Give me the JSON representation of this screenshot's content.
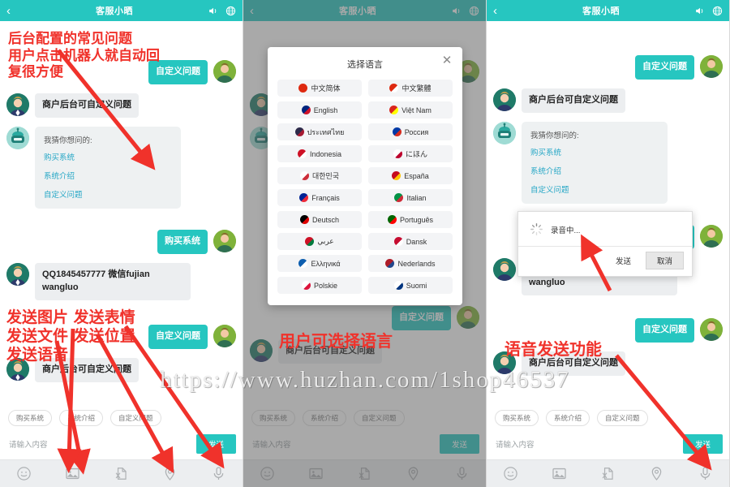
{
  "header": {
    "back_icon": "chevron-left-icon",
    "title": "客服小晒",
    "sound_icon": "sound-icon",
    "globe_icon": "globe-icon"
  },
  "chat": {
    "bot_question_intro": "我猜你想问的:",
    "faq_links": [
      "购买系统",
      "系统介绍",
      "自定义问题"
    ],
    "agent_msg": "商户后台可自定义问题",
    "user_msg_buy": "购买系统",
    "agent_contact": "QQ1845457777 微信fujian wangluo",
    "user_msg_custom": "自定义问题"
  },
  "chips": [
    "购买系统",
    "系统介绍",
    "自定义问题"
  ],
  "input": {
    "placeholder": "请输入内容",
    "send_label": "发送"
  },
  "toolbar": {
    "items": [
      {
        "icon": "smiley-icon",
        "name": "emoji-button"
      },
      {
        "icon": "image-icon",
        "name": "image-button"
      },
      {
        "icon": "file-icon",
        "name": "file-button"
      },
      {
        "icon": "location-pin-icon",
        "name": "location-button"
      },
      {
        "icon": "microphone-icon",
        "name": "voice-button"
      }
    ]
  },
  "annotations": {
    "left": "后台配置的常见问题\n用户点击机器人就自动回\n复很方便",
    "left2": "发送图片 发送表情\n发送文件 发送位置\n发送语音",
    "middle": "用户可选择语言",
    "right": "语音发送功能"
  },
  "language_modal": {
    "title": "选择语言",
    "close_icon": "close-icon",
    "items": [
      {
        "label": "中文简体",
        "flag": "#de2910",
        "flag2": "#de2910"
      },
      {
        "label": "中文繁體",
        "flag": "#de2910",
        "flag2": "#ffffff"
      },
      {
        "label": "English",
        "flag": "#00247d",
        "flag2": "#cf142b"
      },
      {
        "label": "Việt Nam",
        "flag": "#da251d",
        "flag2": "#ffff00"
      },
      {
        "label": "ประเทศไทย",
        "flag": "#2d2a4a",
        "flag2": "#a51931"
      },
      {
        "label": "Россия",
        "flag": "#0039a6",
        "flag2": "#d52b1e"
      },
      {
        "label": "Indonesia",
        "flag": "#ce1126",
        "flag2": "#ffffff"
      },
      {
        "label": "にほん",
        "flag": "#ffffff",
        "flag2": "#bc002d"
      },
      {
        "label": "대한민국",
        "flag": "#ffffff",
        "flag2": "#cd2e3a"
      },
      {
        "label": "España",
        "flag": "#c60b1e",
        "flag2": "#ffc400"
      },
      {
        "label": "Français",
        "flag": "#002395",
        "flag2": "#ed2939"
      },
      {
        "label": "Italian",
        "flag": "#009246",
        "flag2": "#ce2b37"
      },
      {
        "label": "Deutsch",
        "flag": "#000000",
        "flag2": "#dd0000"
      },
      {
        "label": "Português",
        "flag": "#006600",
        "flag2": "#ff0000"
      },
      {
        "label": "عربي",
        "flag": "#ce1126",
        "flag2": "#007a3d"
      },
      {
        "label": "Dansk",
        "flag": "#c60c30",
        "flag2": "#ffffff"
      },
      {
        "label": "Ελληνικά",
        "flag": "#0d5eaf",
        "flag2": "#ffffff"
      },
      {
        "label": "Nederlands",
        "flag": "#ae1c28",
        "flag2": "#21468b"
      },
      {
        "label": "Polskie",
        "flag": "#ffffff",
        "flag2": "#dc143c"
      },
      {
        "label": "Suomi",
        "flag": "#ffffff",
        "flag2": "#003580"
      }
    ]
  },
  "recording_modal": {
    "status": "录音中...",
    "send_label": "发送",
    "cancel_label": "取消",
    "spinner_icon": "loading-spinner-icon"
  },
  "watermark": "https://www.huzhan.com/1shop46537",
  "colors": {
    "accent": "#26c6c0",
    "annotation": "#f0322b",
    "bot_bubble": "#eceef0",
    "link": "#26a7c6"
  }
}
